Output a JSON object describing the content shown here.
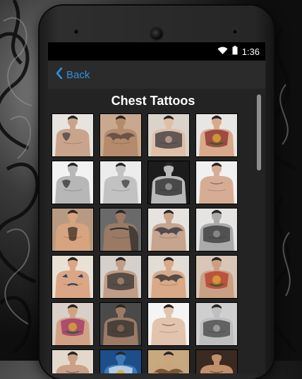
{
  "status": {
    "time": "1:36",
    "wifi_icon": "wifi-icon",
    "battery_icon": "battery-icon"
  },
  "actionbar": {
    "back_label": "Back",
    "back_icon": "chevron-left-icon",
    "accent_color": "#2f8fdc"
  },
  "page": {
    "title": "Chest Tattoos"
  },
  "gallery": {
    "columns": 4,
    "thumbnails": [
      {
        "bg": "#e7e4e0",
        "skin": "#c9a48c",
        "ink": "#3b3b3b",
        "style": "bw"
      },
      {
        "bg": "#c8a98f",
        "skin": "#b68a6c",
        "ink": "#5a4a45",
        "style": "wings"
      },
      {
        "bg": "#d9d3cc",
        "skin": "#e0bfa8",
        "ink": "#2b2b30",
        "style": "full"
      },
      {
        "bg": "#e8e6e4",
        "skin": "#d9a98c",
        "ink": "#8a2c2c",
        "style": "color"
      },
      {
        "bg": "#f2f2f2",
        "skin": "#b7b7b7",
        "ink": "#2a2a2a",
        "style": "bw"
      },
      {
        "bg": "#ececec",
        "skin": "#c2c2c2",
        "ink": "#333",
        "style": "bw-right"
      },
      {
        "bg": "#1c1c1c",
        "skin": "#b9b9b9",
        "ink": "#1a1a1a",
        "style": "full"
      },
      {
        "bg": "#f0f0f0",
        "skin": "#d6ad94",
        "ink": "#3a3a3a",
        "style": "plain"
      },
      {
        "bg": "#b89a83",
        "skin": "#d7a47f",
        "ink": "#3a2f28",
        "style": "center"
      },
      {
        "bg": "#6a6a6a",
        "skin": "#9a7a65",
        "ink": "#2a2a2a",
        "style": "sleeve"
      },
      {
        "bg": "#e6e2de",
        "skin": "#c7a48e",
        "ink": "#3c3c45",
        "style": "wings"
      },
      {
        "bg": "#e6e4e2",
        "skin": "#aaa",
        "ink": "#2c2c2c",
        "style": "full"
      },
      {
        "bg": "#e9e0d6",
        "skin": "#dba686",
        "ink": "#2b3b6b",
        "style": "birds"
      },
      {
        "bg": "#d5d0cb",
        "skin": "#c19c86",
        "ink": "#2b2b2b",
        "style": "full"
      },
      {
        "bg": "#e2dcd6",
        "skin": "#d9a988",
        "ink": "#3b3b3b",
        "style": "wings"
      },
      {
        "bg": "#d8c6b8",
        "skin": "#caa085",
        "ink": "#b43a2a",
        "style": "color"
      },
      {
        "bg": "#d8cfc8",
        "skin": "#d2a184",
        "ink": "#a0326a",
        "style": "color"
      },
      {
        "bg": "#4a4a4a",
        "skin": "#9c7a66",
        "ink": "#2a2a2a",
        "style": "full"
      },
      {
        "bg": "#f4f4f4",
        "skin": "#e2c3ad",
        "ink": "#2a2a2a",
        "style": "plain"
      },
      {
        "bg": "#cfcfcf",
        "skin": "#bfbfbf",
        "ink": "#3a3a3a",
        "style": "full"
      },
      {
        "bg": "#e2d8cc",
        "skin": "#caa087",
        "ink": "#3a3a3a",
        "style": "plain"
      },
      {
        "bg": "#1d4e8a",
        "skin": "#3c79b5",
        "ink": "#d7e8f6",
        "style": "color"
      },
      {
        "bg": "#c8a97f",
        "skin": "#c9a47e",
        "ink": "#6a4a2a",
        "style": "wings"
      },
      {
        "bg": "#3a2a22",
        "skin": "#c28e6b",
        "ink": "#2a1a12",
        "style": "plain"
      }
    ]
  }
}
